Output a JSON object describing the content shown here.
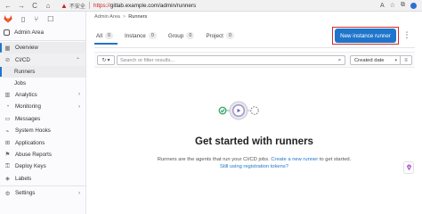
{
  "browser": {
    "back": "←",
    "forward": "→",
    "reload": "C",
    "home": "⌂",
    "warning": "▲",
    "insecure_label": "不安全",
    "url_scheme": "https://",
    "url_rest": "gitlab.example.com/admin/runners"
  },
  "sidebar": {
    "admin_area": "Admin Area",
    "items": [
      {
        "label": "Overview",
        "icon": "grid-icon"
      },
      {
        "label": "CI/CD",
        "icon": "rocket-icon"
      }
    ],
    "cicd_sub": [
      "Runners",
      "Jobs"
    ],
    "items2": [
      {
        "label": "Analytics",
        "icon": "chart-icon"
      },
      {
        "label": "Monitoring",
        "icon": "monitor-icon"
      },
      {
        "label": "Messages",
        "icon": "message-icon"
      },
      {
        "label": "System Hooks",
        "icon": "hook-icon"
      },
      {
        "label": "Applications",
        "icon": "applications-icon"
      },
      {
        "label": "Abuse Reports",
        "icon": "flag-icon"
      },
      {
        "label": "Deploy Keys",
        "icon": "key-icon"
      },
      {
        "label": "Labels",
        "icon": "label-icon"
      },
      {
        "label": "Settings",
        "icon": "settings-icon"
      }
    ]
  },
  "breadcrumb": {
    "parent": "Admin Area",
    "current": "Runners",
    "separator": ">"
  },
  "tabs": [
    {
      "label": "All",
      "count": "0"
    },
    {
      "label": "Instance",
      "count": "0"
    },
    {
      "label": "Group",
      "count": "0"
    },
    {
      "label": "Project",
      "count": "0"
    }
  ],
  "actions": {
    "new_runner": "New instance runner",
    "more": "⋮"
  },
  "filter": {
    "placeholder": "Search or filter results...",
    "sort_label": "Created date"
  },
  "empty_state": {
    "title": "Get started with runners",
    "desc_prefix": "Runners are the agents that run your CI/CD jobs. ",
    "create_link": "Create a new runner",
    "desc_suffix": " to get started.",
    "registration_link": "Still using registration tokens?"
  },
  "colors": {
    "accent": "#1f75cb",
    "highlight_frame": "#d42a2a"
  }
}
